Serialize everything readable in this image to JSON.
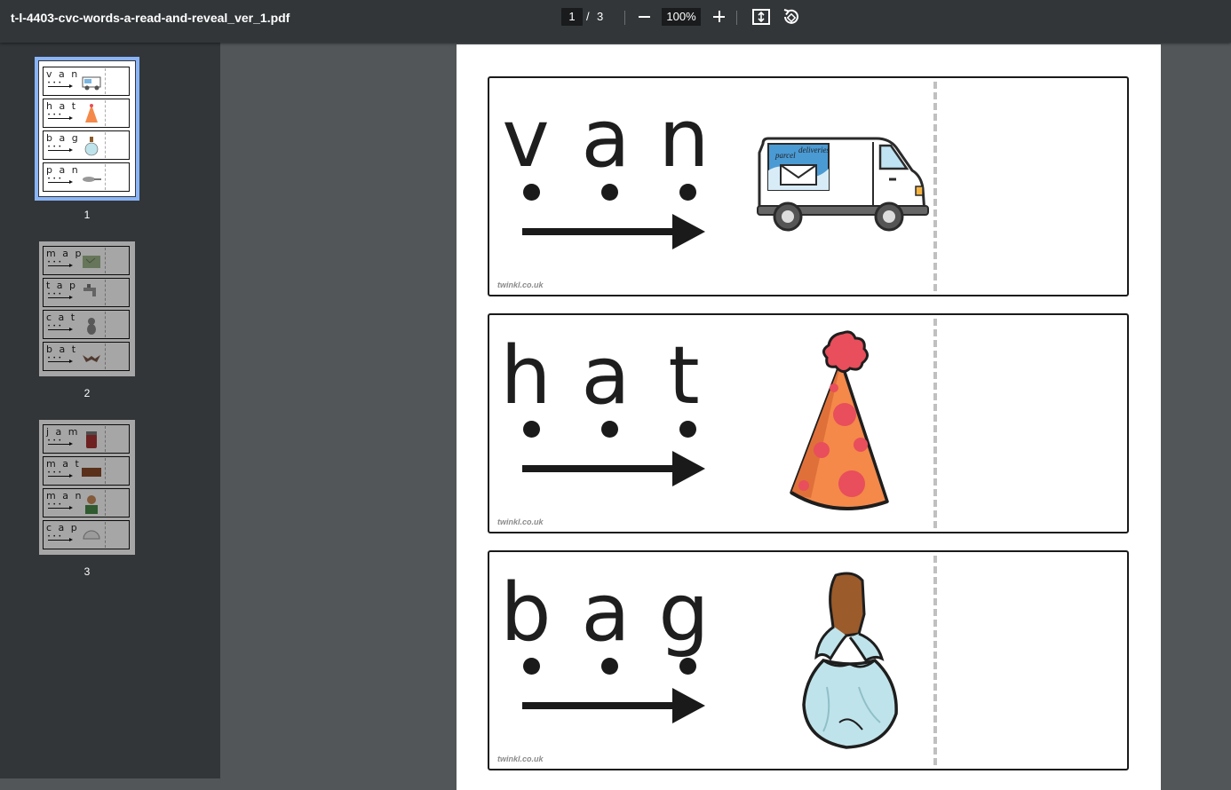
{
  "toolbar": {
    "title": "t-l-4403-cvc-words-a-read-and-reveal_ver_1.pdf",
    "current_page": "1",
    "separator": "/",
    "total_pages": "3",
    "zoom": "100%"
  },
  "sidebar": {
    "thumbnails": [
      {
        "number": "1",
        "words": [
          "van",
          "hat",
          "bag",
          "pan"
        ],
        "active": true
      },
      {
        "number": "2",
        "words": [
          "map",
          "tap",
          "cat",
          "bat"
        ],
        "active": false
      },
      {
        "number": "3",
        "words": [
          "jam",
          "mat",
          "man",
          "cap"
        ],
        "active": false
      }
    ]
  },
  "page": {
    "cards": [
      {
        "letters": [
          "v",
          "a",
          "n"
        ],
        "picture": "van-icon",
        "watermark": "twinkl.co.uk"
      },
      {
        "letters": [
          "h",
          "a",
          "t"
        ],
        "picture": "party-hat-icon",
        "watermark": "twinkl.co.uk"
      },
      {
        "letters": [
          "b",
          "a",
          "g"
        ],
        "picture": "bag-icon",
        "watermark": "twinkl.co.uk"
      }
    ]
  },
  "colors": {
    "toolbar": "#323639",
    "viewer_background": "#525659",
    "active_thumbnail_outline": "#8ab4f8",
    "hat_orange": "#f4894a",
    "hat_spots": "#e84e5b",
    "bag_blue": "#bfe3ea"
  }
}
